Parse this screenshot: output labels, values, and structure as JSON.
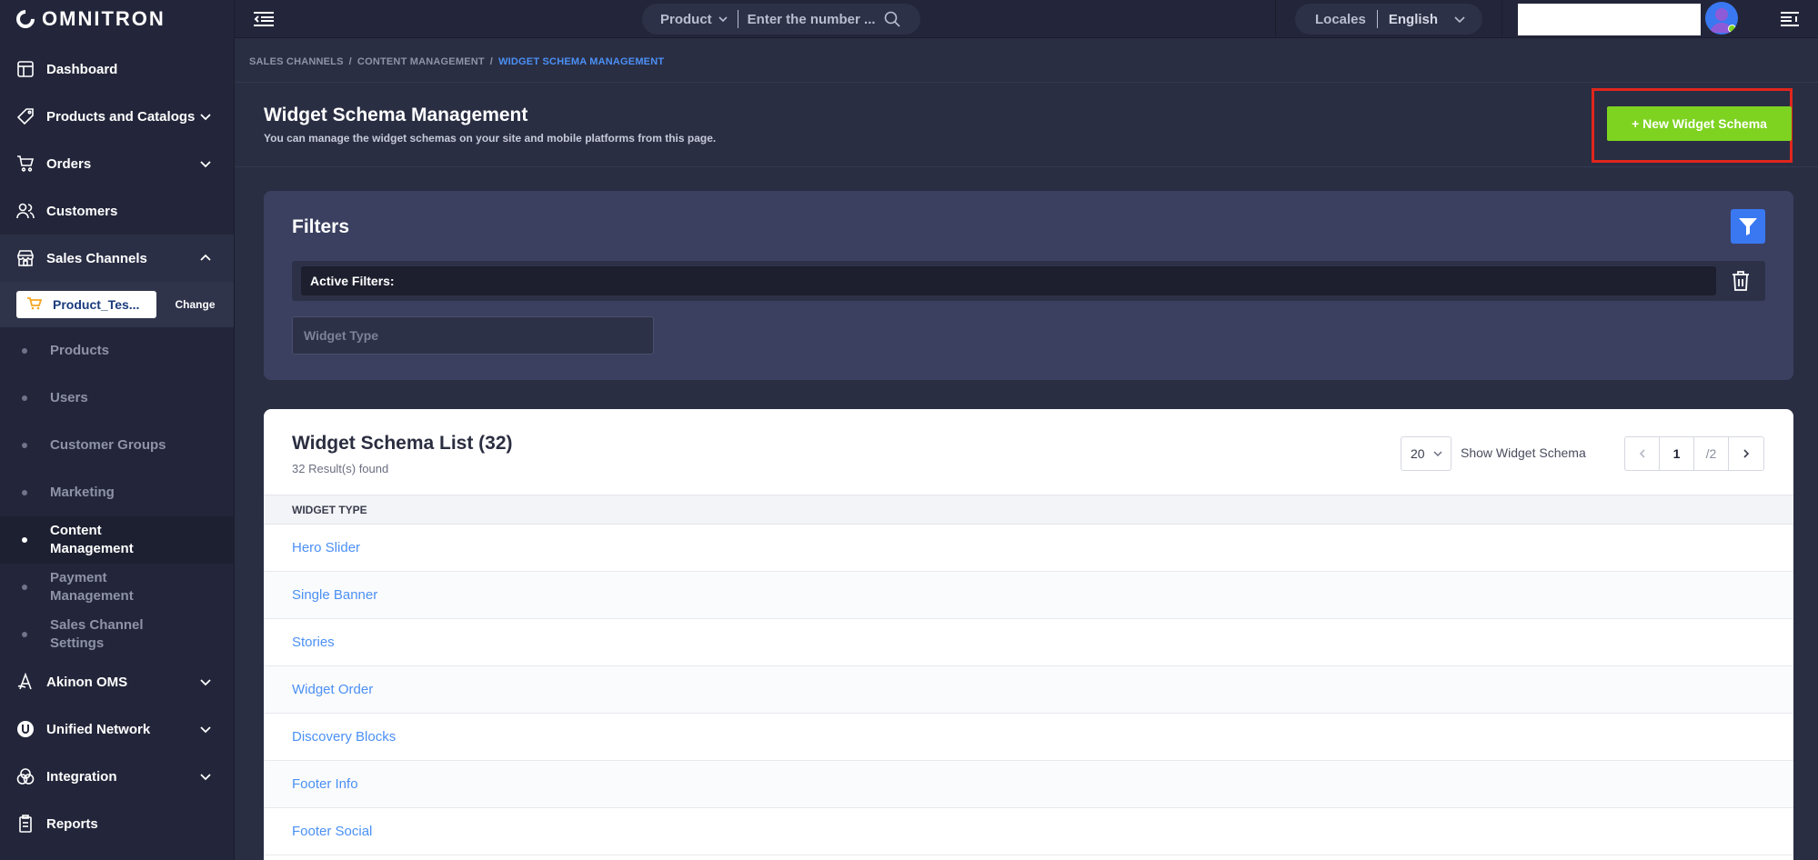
{
  "app": {
    "name": "OMNITRON"
  },
  "sidebar": {
    "items": [
      {
        "label": "Dashboard",
        "icon": "dashboard-icon"
      },
      {
        "label": "Products and Catalogs",
        "icon": "tag-icon"
      },
      {
        "label": "Orders",
        "icon": "cart-icon"
      },
      {
        "label": "Customers",
        "icon": "users-icon"
      },
      {
        "label": "Sales Channels",
        "icon": "store-icon"
      }
    ],
    "channel": {
      "name": "Product_Tes...",
      "change_label": "Change"
    },
    "sub_items": [
      {
        "label": "Products"
      },
      {
        "label": "Users"
      },
      {
        "label": "Customer Groups"
      },
      {
        "label": "Marketing"
      },
      {
        "label": "Content Management"
      },
      {
        "label": "Payment Management"
      },
      {
        "label": "Sales Channel Settings"
      }
    ],
    "bottom_items": [
      {
        "label": "Akinon OMS",
        "icon": "oms-icon"
      },
      {
        "label": "Unified Network",
        "icon": "unified-network-icon"
      },
      {
        "label": "Integration",
        "icon": "integration-icon"
      },
      {
        "label": "Reports",
        "icon": "reports-icon"
      }
    ]
  },
  "topbar": {
    "search_type": "Product",
    "search_placeholder": "Enter the number ...",
    "locale_label": "Locales",
    "locale_value": "English"
  },
  "breadcrumb": {
    "items": [
      "SALES CHANNELS",
      "CONTENT MANAGEMENT",
      "WIDGET SCHEMA MANAGEMENT"
    ]
  },
  "header": {
    "title": "Widget Schema Management",
    "subtitle": "You can manage the widget schemas on your site and mobile platforms from this page.",
    "new_button": "+ New Widget Schema"
  },
  "filters": {
    "title": "Filters",
    "active_label": "Active Filters:",
    "widget_type_placeholder": "Widget Type"
  },
  "list": {
    "title": "Widget Schema List (32)",
    "count": "32 Result(s) found",
    "page_size": "20",
    "show_label": "Show Widget Schema",
    "current_page": "1",
    "total_pages": "/2",
    "column": "WIDGET TYPE",
    "rows": [
      "Hero Slider",
      "Single Banner",
      "Stories",
      "Widget Order",
      "Discovery Blocks",
      "Footer Info",
      "Footer Social"
    ]
  },
  "colors": {
    "accent": "#4b90f5",
    "primary_button": "#7ed321",
    "highlight": "#e0261d",
    "sidebar_bg": "#23263a"
  }
}
